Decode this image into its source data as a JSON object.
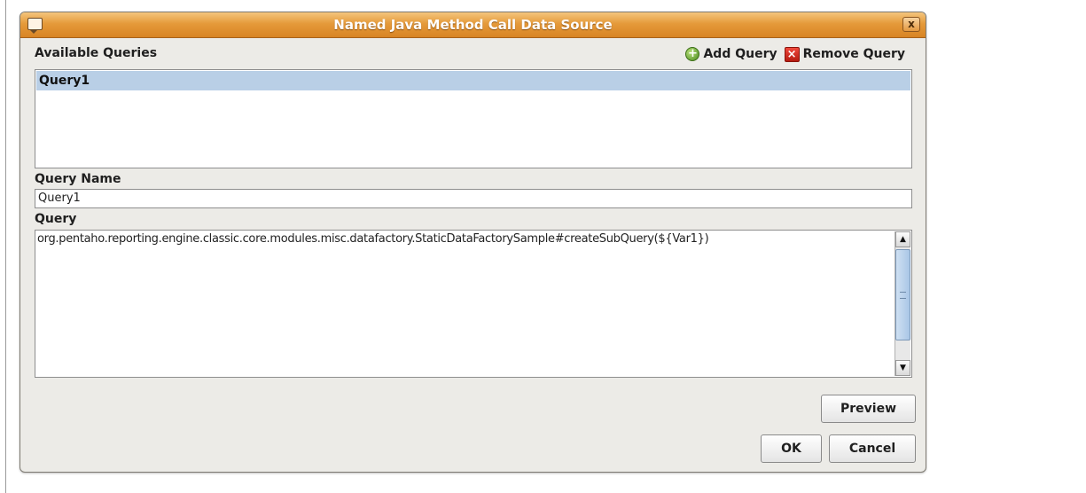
{
  "window": {
    "title": "Named Java Method Call Data Source",
    "close_glyph": "x"
  },
  "queries_panel": {
    "label": "Available Queries",
    "add_label": "Add Query",
    "remove_label": "Remove Query",
    "add_icon": "add-circle-icon",
    "remove_icon": "remove-x-icon",
    "items": [
      "Query1"
    ],
    "selected": "Query1"
  },
  "query_name": {
    "label": "Query Name",
    "value": "Query1"
  },
  "query": {
    "label": "Query",
    "value": "org.pentaho.reporting.engine.classic.core.modules.misc.datafactory.StaticDataFactorySample#createSubQuery(${Var1})"
  },
  "buttons": {
    "preview": "Preview",
    "ok": "OK",
    "cancel": "Cancel"
  },
  "colors": {
    "titlebar": "#e59a3a",
    "selection": "#b9cfe6",
    "dialog_bg": "#ecebe7"
  }
}
